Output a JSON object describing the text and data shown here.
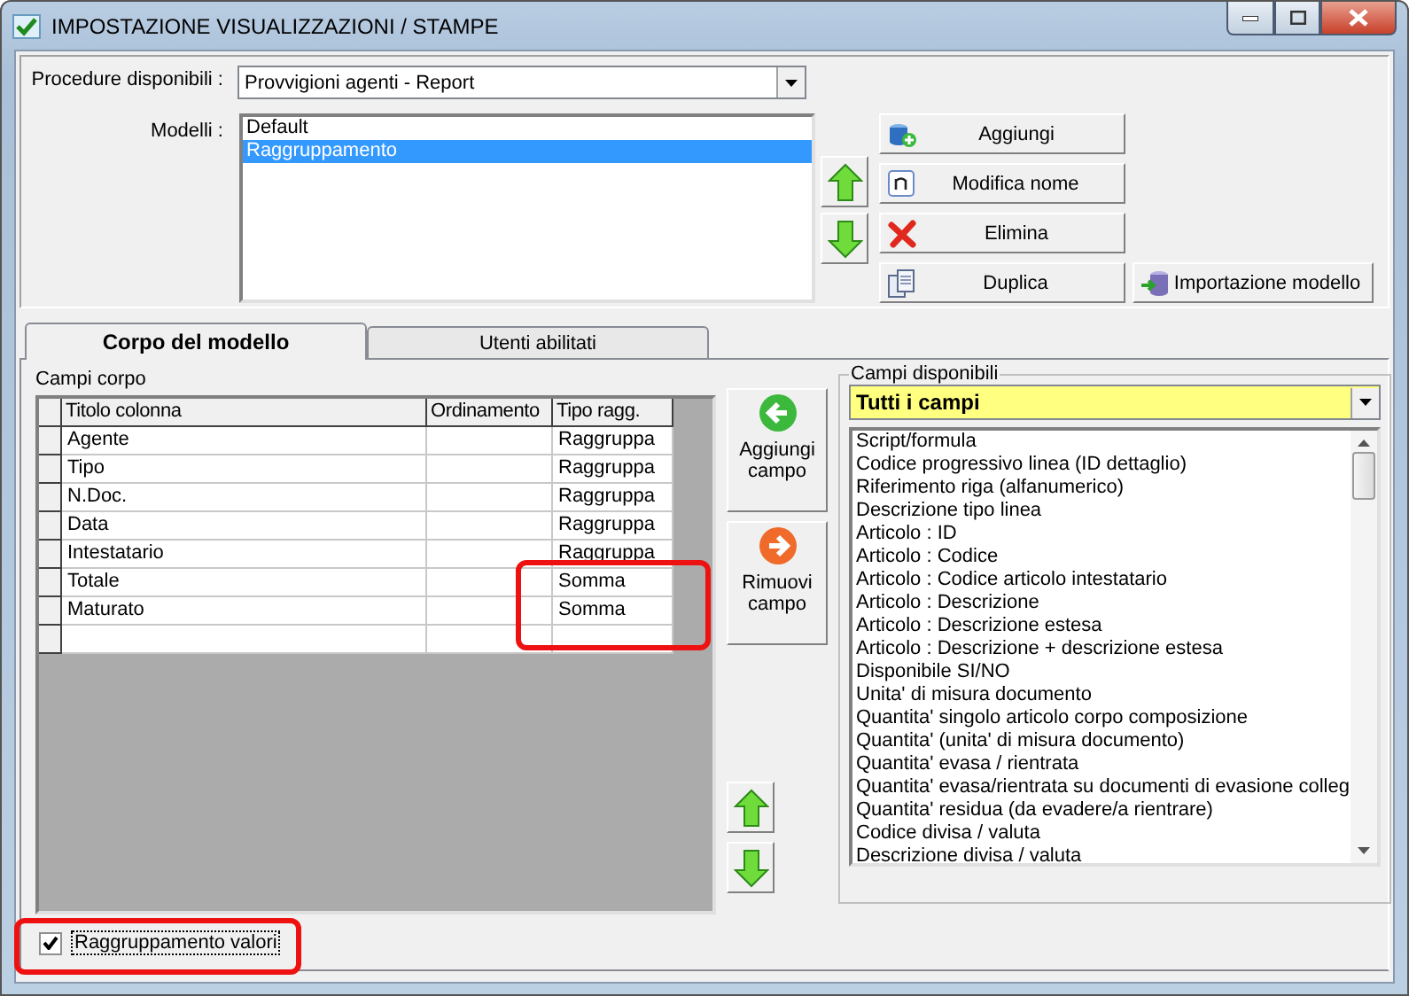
{
  "window": {
    "title": "IMPOSTAZIONE VISUALIZZAZIONI / STAMPE"
  },
  "procedure": {
    "label": "Procedure disponibili :",
    "value": "Provvigioni agenti - Report"
  },
  "models": {
    "label": "Modelli :",
    "items": [
      {
        "name": "Default",
        "selected": false
      },
      {
        "name": "Raggruppamento",
        "selected": true
      }
    ]
  },
  "model_buttons": [
    {
      "label": "Aggiungi",
      "kind": "add"
    },
    {
      "label": "Modifica nome",
      "kind": "rename"
    },
    {
      "label": "Elimina",
      "kind": "delete"
    },
    {
      "label": "Duplica",
      "kind": "duplicate"
    },
    {
      "label": "Importazione modello",
      "kind": "import"
    }
  ],
  "tabs": [
    {
      "label": "Corpo del modello",
      "selected": true
    },
    {
      "label": "Utenti abilitati",
      "selected": false
    }
  ],
  "body_fields": {
    "label": "Campi corpo",
    "column_1": "Titolo colonna",
    "column_2": "Ordinamento",
    "column_3": "Tipo ragg.",
    "rows": [
      {
        "title": "Agente",
        "grouping": "Raggruppa"
      },
      {
        "title": "Tipo",
        "grouping": "Raggruppa"
      },
      {
        "title": "N.Doc.",
        "grouping": "Raggruppa"
      },
      {
        "title": "Data",
        "grouping": "Raggruppa"
      },
      {
        "title": "Intestatario",
        "grouping": "Raggruppa"
      },
      {
        "title": "Totale",
        "grouping": "Somma"
      },
      {
        "title": "Maturato",
        "grouping": "Somma"
      }
    ]
  },
  "field_buttons": [
    {
      "label": "Aggiungi campo",
      "kind": "add"
    },
    {
      "label": "Rimuovi campo",
      "kind": "remove"
    }
  ],
  "available": {
    "label": "Campi disponibili",
    "filter": "Tutti i campi",
    "items": [
      "Script/formula",
      "Codice progressivo linea (ID dettaglio)",
      "Riferimento riga (alfanumerico)",
      "Descrizione tipo linea",
      "Articolo : ID",
      "Articolo : Codice",
      "Articolo : Codice articolo intestatario",
      "Articolo : Descrizione",
      "Articolo : Descrizione estesa",
      "Articolo : Descrizione + descrizione estesa",
      "Disponibile SI/NO",
      "Unita' di misura documento",
      "Quantita' singolo articolo corpo composizione",
      "Quantita' (unita' di misura documento)",
      "Quantita' evasa / rientrata",
      "Quantita' evasa/rientrata su documenti di evasione colleg",
      "Quantita' residua (da evadere/a rientrare)",
      "Codice divisa / valuta",
      "Descrizione divisa / valuta"
    ]
  },
  "grouping_checkbox": {
    "label": "Raggruppamento valori",
    "checked": true
  }
}
